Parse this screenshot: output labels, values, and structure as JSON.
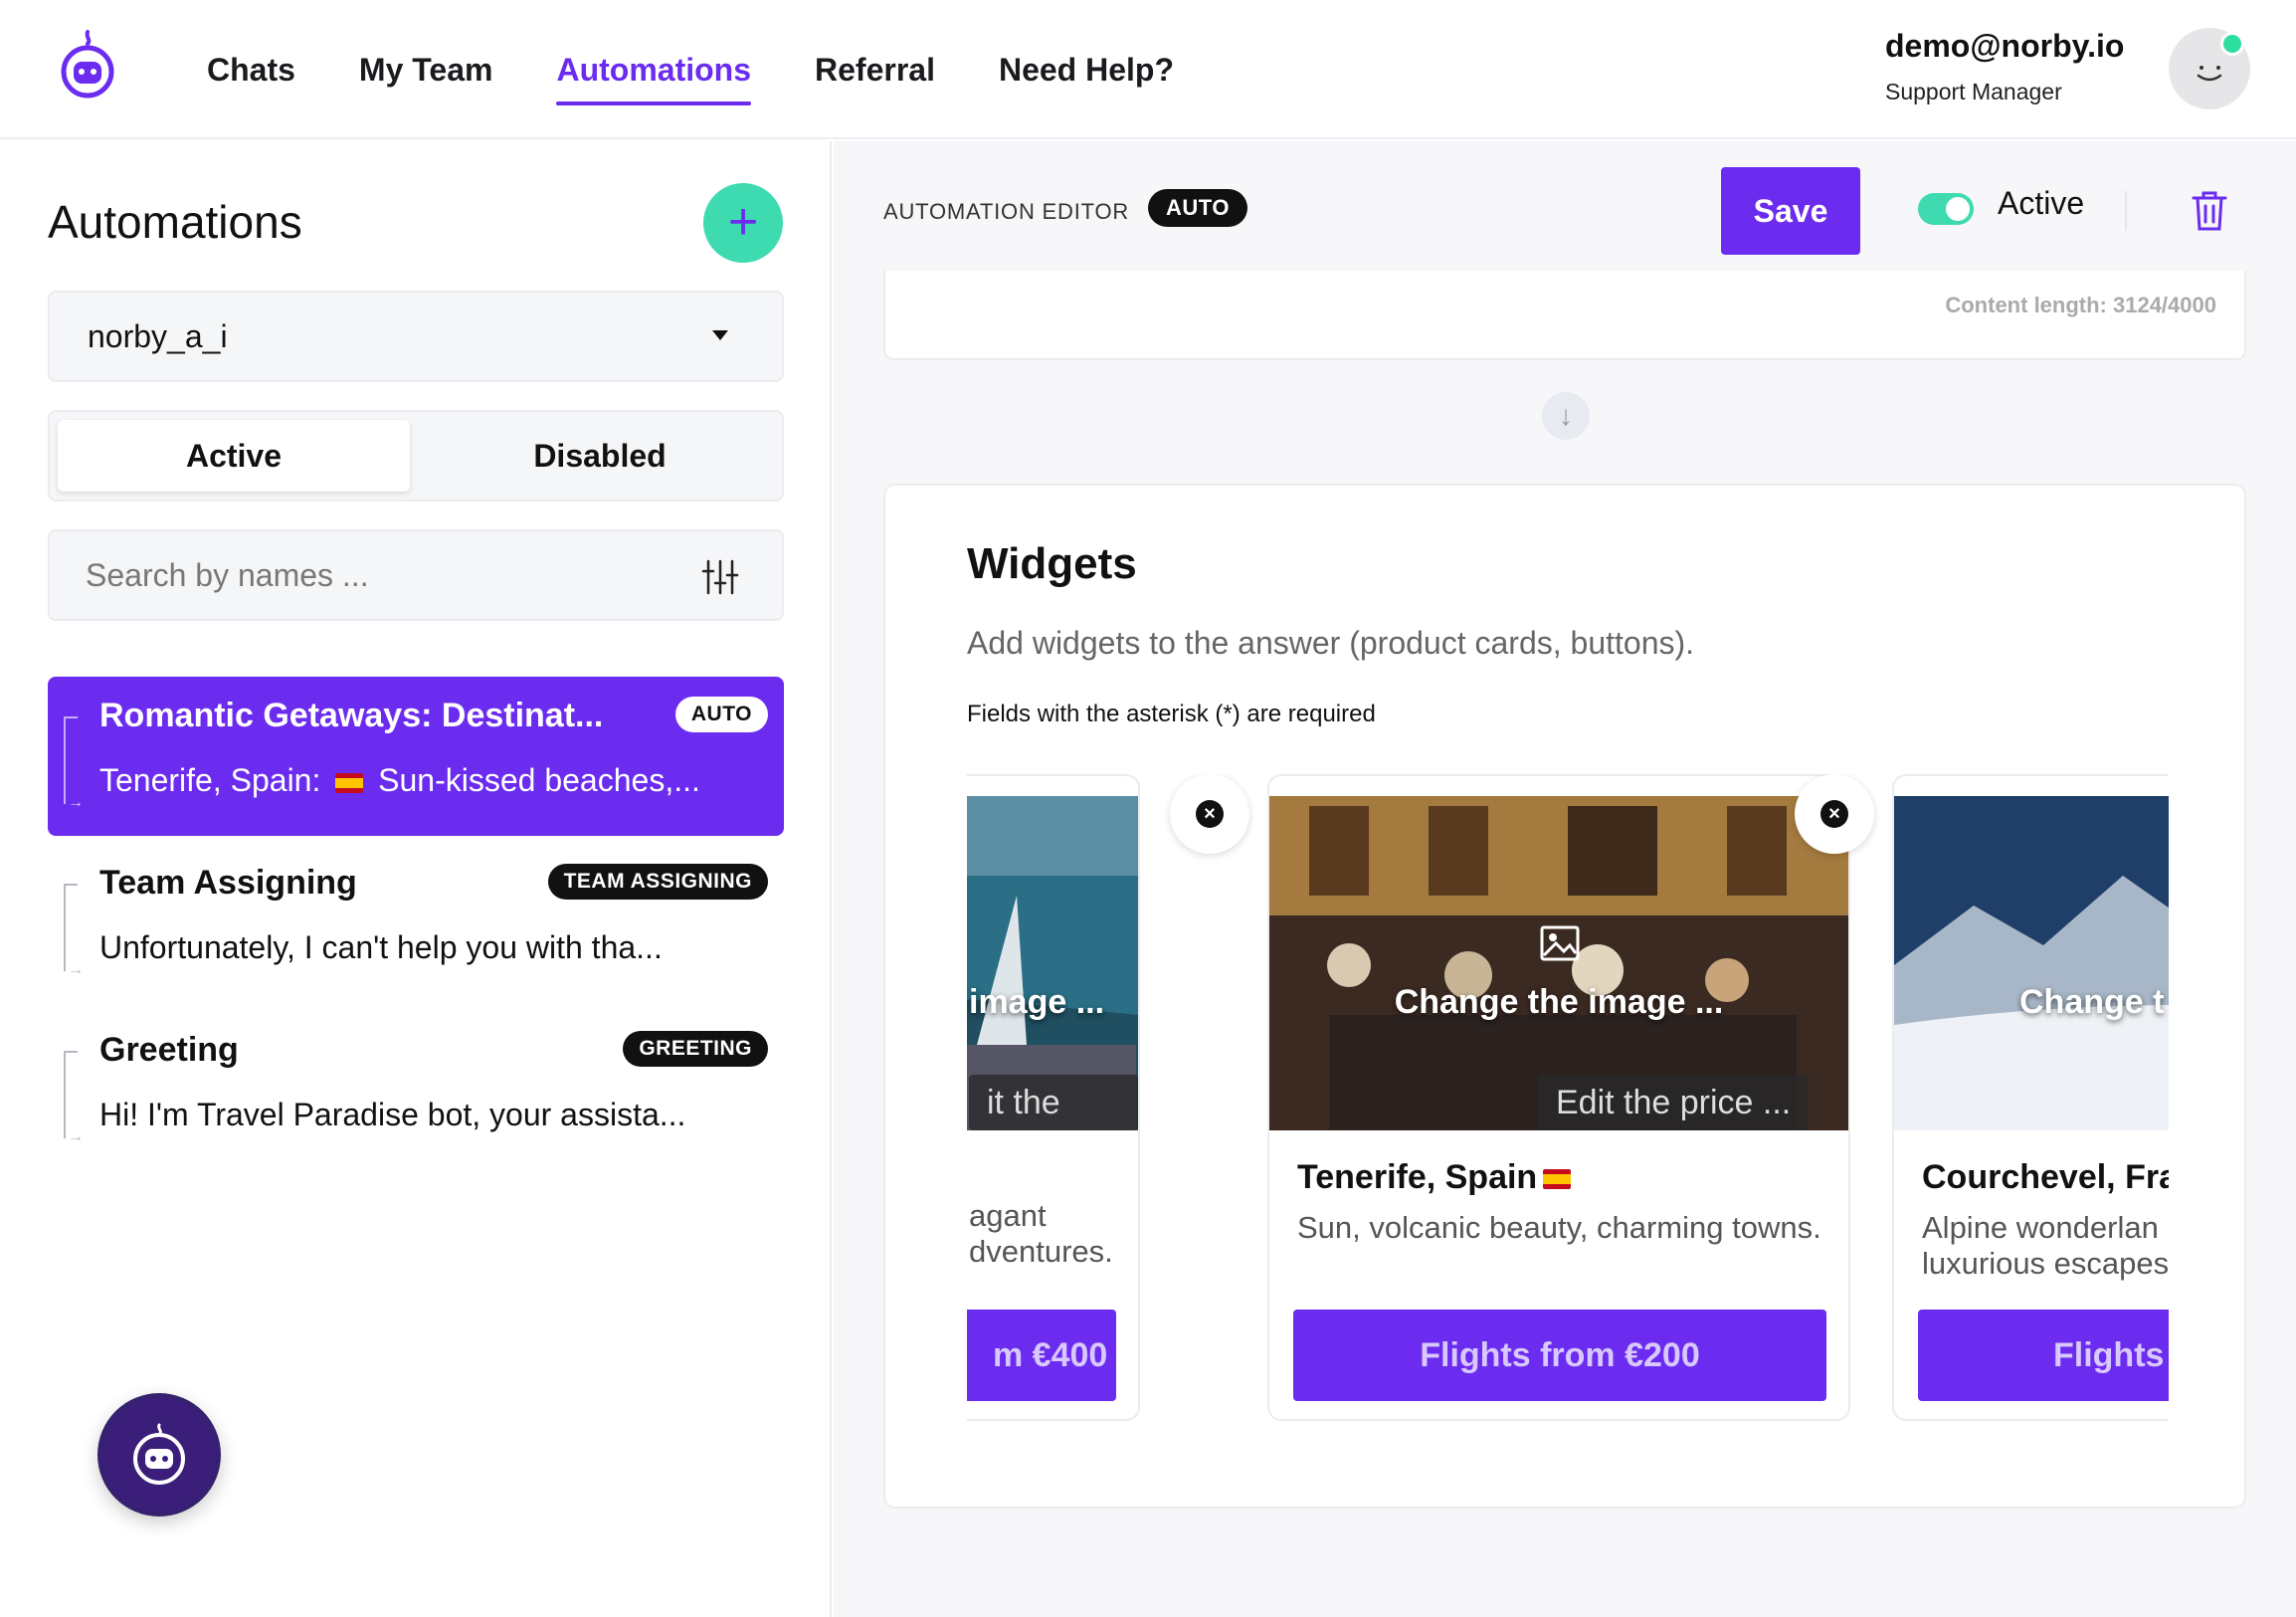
{
  "nav": {
    "items": [
      {
        "label": "Chats",
        "active": false
      },
      {
        "label": "My Team",
        "active": false
      },
      {
        "label": "Automations",
        "active": true
      },
      {
        "label": "Referral",
        "active": false
      },
      {
        "label": "Need Help?",
        "active": false
      }
    ],
    "accent_color": "#6b2cf0"
  },
  "user": {
    "email": "demo@norby.io",
    "role": "Support Manager",
    "status_color": "#2ddea0"
  },
  "sidebar": {
    "title": "Automations",
    "bot_select": "norby_a_i",
    "segments": {
      "active": "Active",
      "disabled": "Disabled"
    },
    "search_placeholder": "Search by names ...",
    "items": [
      {
        "title": "Romantic Getaways: Destinat...",
        "badge": "AUTO",
        "subtitle_before": "Tenerife, Spain:",
        "subtitle_after": "Sun-kissed beaches,...",
        "selected": true
      },
      {
        "title": "Team Assigning",
        "badge": "TEAM ASSIGNING",
        "subtitle": "Unfortunately, I can't help you with tha...",
        "selected": false
      },
      {
        "title": "Greeting",
        "badge": "GREETING",
        "subtitle": "Hi! I'm Travel Paradise bot, your assista...",
        "selected": false
      }
    ]
  },
  "editor": {
    "label": "AUTOMATION EDITOR",
    "badge": "AUTO",
    "save": "Save",
    "active_label": "Active",
    "active": true,
    "content_length": "Content length: 3124/4000"
  },
  "widgets": {
    "title": "Widgets",
    "description": "Add widgets to the answer (product cards, buttons).",
    "required_note": "Fields with the asterisk (*) are required",
    "cards": [
      {
        "image_overlay": "image ...",
        "price_overlay": "it the price ...",
        "title": "",
        "desc_line1": "agant",
        "desc_line2": "dventures.",
        "button": "m €400"
      },
      {
        "image_overlay": "Change the image ...",
        "price_overlay": "Edit the price ...",
        "title": "Tenerife, Spain",
        "desc_line1": "Sun, volcanic beauty, charming towns.",
        "desc_line2": "",
        "button": "Flights from €200"
      },
      {
        "image_overlay": "Change t",
        "price_overlay": "",
        "title": "Courchevel, Fra",
        "desc_line1": "Alpine wonderlan",
        "desc_line2": "luxurious escapes",
        "button": "Flights"
      }
    ]
  }
}
